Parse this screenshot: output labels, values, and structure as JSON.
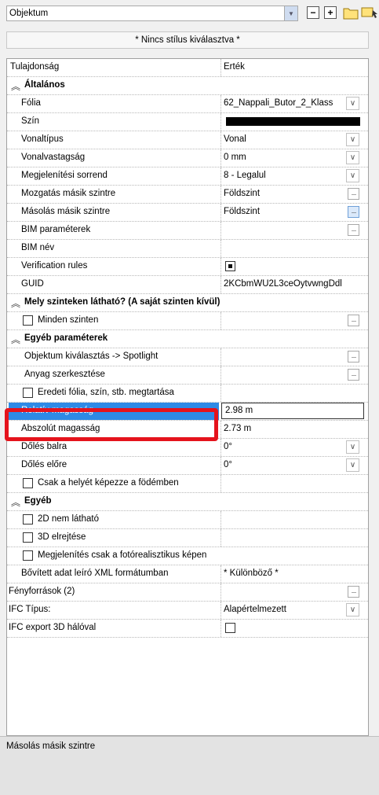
{
  "object_selector": {
    "value": "Objektum"
  },
  "toolbar": {
    "remove_symbol": "−",
    "add_symbol": "+"
  },
  "style_bar": {
    "label": "* Nincs stílus kiválasztva *"
  },
  "grid": {
    "header": {
      "property": "Tulajdonság",
      "value": "Érték"
    },
    "categories": {
      "general": "Általános",
      "visibility": "Mely szinteken látható? (A saját szinten kívül)",
      "other_params": "Egyéb paraméterek",
      "other": "Egyéb"
    },
    "rows": {
      "folia": {
        "label": "Fólia",
        "value": "62_Nappali_Butor_2_Klass"
      },
      "szin": {
        "label": "Szín"
      },
      "vonaltipus": {
        "label": "Vonaltípus",
        "value": "Vonal"
      },
      "vonalvastagsag": {
        "label": "Vonalvastagság",
        "value": "0 mm"
      },
      "megjelenitesi": {
        "label": "Megjelenítési sorrend",
        "value": "8 - Legalul"
      },
      "mozgatas": {
        "label": "Mozgatás másik szintre",
        "value": "Földszint"
      },
      "masolas": {
        "label": "Másolás másik szintre",
        "value": "Földszint"
      },
      "bim_param": {
        "label": "BIM paraméterek"
      },
      "bim_nev": {
        "label": "BIM név"
      },
      "verification": {
        "label": "Verification rules"
      },
      "guid": {
        "label": "GUID",
        "value": "2KCbmWU2L3ceOytvwngDdl"
      },
      "minden_szinten": {
        "label": "Minden szinten"
      },
      "obj_kivalasztas": {
        "label": "Objektum kiválasztás -> Spotlight"
      },
      "anyag": {
        "label": "Anyag szerkesztése"
      },
      "eredeti": {
        "label": "Eredeti fólia, szín, stb. megtartása"
      },
      "relativ": {
        "label": "Relatív magasság",
        "value": "2.98 m"
      },
      "abszolut": {
        "label": "Abszolút magasság",
        "value": "2.73 m"
      },
      "doles_balra": {
        "label": "Dőlés balra",
        "value": "0°"
      },
      "doles_elore": {
        "label": "Dőlés előre",
        "value": "0°"
      },
      "csak_helyet": {
        "label": "Csak a helyét képezze a födémben"
      },
      "nem_lathato_2d": {
        "label": "2D nem látható"
      },
      "elrejtes_3d": {
        "label": "3D elrejtése"
      },
      "megjelenites_foto": {
        "label": "Megjelenítés csak a fotórealisztikus képen"
      },
      "bovitett": {
        "label": "Bővített adat leíró XML formátumban",
        "value": "* Különböző *"
      },
      "fenyforrasok": {
        "label": "Fényforrások (2)"
      },
      "ifc_tipus": {
        "label": "IFC Típus:",
        "value": "Alapértelmezett"
      },
      "ifc_export": {
        "label": "IFC export 3D hálóval"
      }
    }
  },
  "status_bar": {
    "text": "Másolás másik szintre"
  },
  "colors": {
    "selection": "#2e8ae6",
    "highlight_box": "#e5131c",
    "color_swatch": "#000000"
  }
}
